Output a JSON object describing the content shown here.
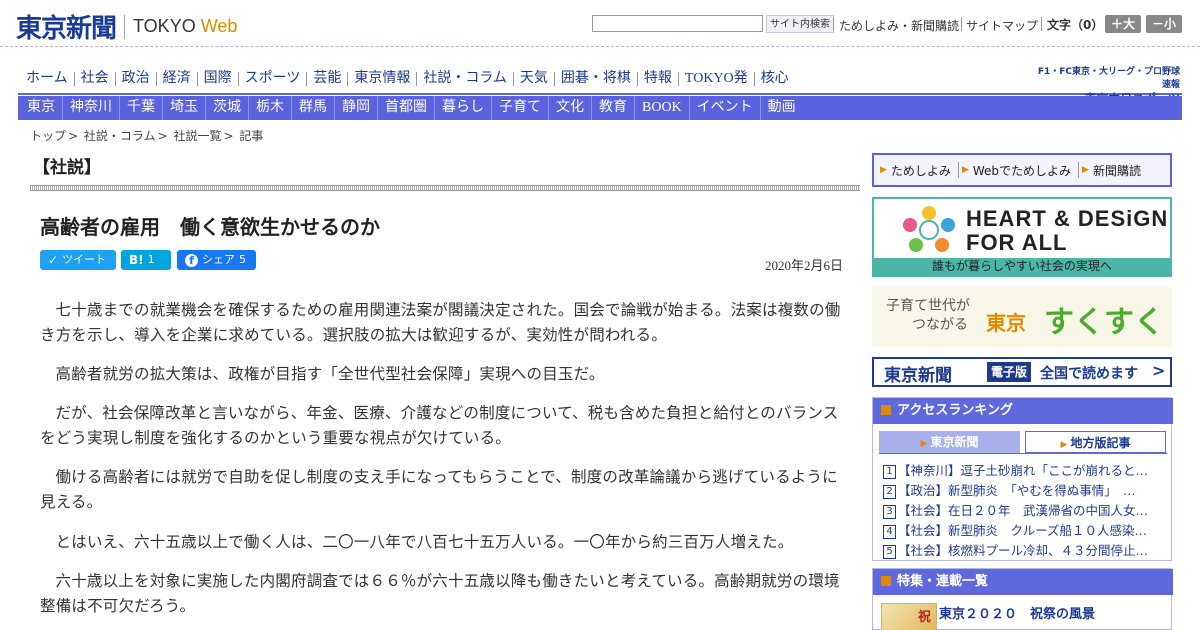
{
  "header": {
    "logo_kanji": "東京新聞",
    "logo_tokyo": "TOKYO",
    "logo_web": "Web",
    "search_button": "サイト内検索",
    "links": [
      "ためしよみ・新聞購読",
      "サイトマップ"
    ],
    "font_size_label": "文字（0）",
    "font_larger": "＋大",
    "font_smaller": "－小"
  },
  "nav_main": [
    "ホーム",
    "社会",
    "政治",
    "経済",
    "国際",
    "スポーツ",
    "芸能",
    "東京情報",
    "社説・コラム",
    "天気",
    "囲碁・将棋",
    "特報",
    "TOKYO発",
    "核心"
  ],
  "sports_ad": {
    "top": "F1・FC東京・大リーグ・プロ野球速報",
    "bottom": "東京中日スポーツ"
  },
  "nav_regional": [
    "東京",
    "神奈川",
    "千葉",
    "埼玉",
    "茨城",
    "栃木",
    "群馬",
    "静岡",
    "首都圏",
    "暮らし",
    "子育て",
    "文化",
    "教育",
    "BOOK",
    "イベント",
    "動画"
  ],
  "breadcrumb": [
    "トップ",
    "社説・コラム",
    "社説一覧",
    "記事"
  ],
  "article": {
    "section": "【社説】",
    "title": "高齢者の雇用　働く意欲生かせるのか",
    "date": "2020年2月6日",
    "share": {
      "tweet": "ツイート",
      "hatena": "B!",
      "hatena_count": "1",
      "facebook": "シェア",
      "facebook_count": "5"
    },
    "paragraphs": [
      "七十歳までの就業機会を確保するための雇用関連法案が閣議決定された。国会で論戦が始まる。法案は複数の働き方を示し、導入を企業に求めている。選択肢の拡大は歓迎するが、実効性が問われる。",
      "高齢者就労の拡大策は、政権が目指す「全世代型社会保障」実現への目玉だ。",
      "だが、社会保障改革と言いながら、年金、医療、介護などの制度について、税も含めた負担と給付とのバランスをどう実現し制度を強化するのかという重要な視点が欠けている。",
      "働ける高齢者には就労で自助を促し制度の支え手になってもらうことで、制度の改革論議から逃げているように見える。",
      "とはいえ、六十五歳以上で働く人は、二〇一八年で八百七十五万人いる。一〇年から約三百万人増えた。",
      "六十歳以上を対象に実施した内閣府調査では６６％が六十五歳以降も働きたいと考えている。高齢期就労の環境整備は不可欠だろう。"
    ]
  },
  "sidebar": {
    "promo": [
      "ためしよみ",
      "Webでためしよみ",
      "新聞購読"
    ],
    "heart_design": {
      "title_line1": "HEART & DESiGN",
      "title_line2": "FOR ALL",
      "footer": "誰もが暮らしやすい社会の実現へ"
    },
    "sukusuku": {
      "sub1": "子育て世代が",
      "sub2": "つながる",
      "tokyo": "東京",
      "name": "すくすく"
    },
    "denshi": {
      "logo": "東京新聞",
      "tag": "電子版",
      "text": "全国で読めます",
      "arrow": ">"
    },
    "ranking": {
      "header": "アクセスランキング",
      "tabs": [
        "東京新聞",
        "地方版記事"
      ],
      "items": [
        "【神奈川】逗子土砂崩れ「ここが崩れると…",
        "【政治】新型肺炎　「やむを得ぬ事情」　…",
        "【社会】在日２０年　武漢帰省の中国人女…",
        "【社会】新型肺炎　クルーズ船１０人感染…",
        "【社会】核燃料プール冷却、４３分間停止…"
      ]
    },
    "feature": {
      "header": "特集・連載一覧",
      "item_title": "東京２０２０　祝祭の風景",
      "thumb_text": "祝"
    }
  },
  "colors": {
    "brand_blue": "#1e3a8f",
    "nav_purple": "#5a62de",
    "accent_orange": "#e08a00",
    "teal": "#4bb6a8"
  }
}
